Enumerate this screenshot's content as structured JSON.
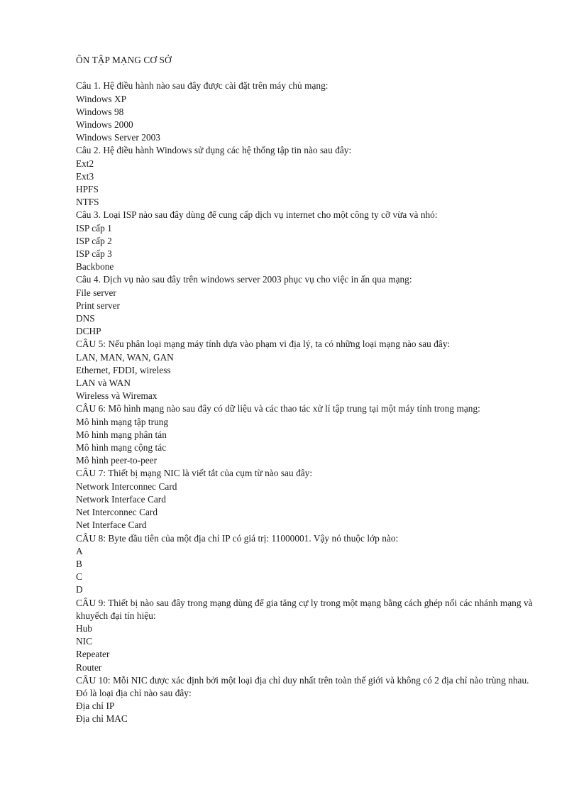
{
  "document": {
    "title": "ÔN TẬP MẠNG CƠ SỞ",
    "language": "Vietnamese",
    "page_background": "#ffffff",
    "text_color": "#1a1a1a",
    "questions": [
      {
        "stem": "Câu 1. Hệ điều hành nào sau đây được cài đặt trên máy chủ mạng:",
        "choices": [
          "Windows XP",
          "Windows 98",
          "Windows 2000",
          "Windows Server 2003"
        ]
      },
      {
        "stem": "Câu 2. Hệ điều hành Windows sử dụng các hệ thống tập tin nào sau đây:",
        "choices": [
          "Ext2",
          "Ext3",
          "HPFS",
          "NTFS"
        ]
      },
      {
        "stem": "Câu 3. Loại ISP nào sau đây dùng để cung cấp dịch vụ internet cho một công ty cỡ vừa và nhỏ:",
        "choices": [
          "ISP cấp 1",
          "ISP cấp 2",
          "ISP cấp 3",
          "Backbone"
        ]
      },
      {
        "stem": "Câu 4. Dịch vụ nào sau đây trên windows server 2003 phục vụ cho việc in ấn qua mạng:",
        "choices": [
          "File server",
          "Print server",
          "DNS",
          "DCHP"
        ]
      },
      {
        "stem": "CÂU 5: Nếu phân loại mạng máy tính dựa vào phạm vi địa lý, ta có những loại mạng nào sau đây:",
        "choices": [
          "LAN, MAN, WAN, GAN",
          "Ethernet, FDDI, wireless",
          "LAN và WAN",
          "Wireless và Wiremax"
        ]
      },
      {
        "stem": "CÂU 6: Mô hình mạng nào sau đây có dữ liệu và các thao tác xử lí tập trung tại một máy tính trong mạng:",
        "choices": [
          "Mô hình mạng tập trung",
          "Mô hình mạng phân tán",
          "Mô hình mạng cộng tác",
          "Mô hình peer-to-peer"
        ]
      },
      {
        "stem": "CÂU 7: Thiết bị mạng NIC là viết tắt của cụm từ nào sau đây:",
        "choices": [
          "Network Interconnec Card",
          "Network Interface Card",
          "Net Interconnec Card",
          "Net Interface Card"
        ]
      },
      {
        "stem": "CÂU 8: Byte đầu tiên của một địa chỉ IP có giá trị: 11000001. Vậy nó thuộc lớp nào:",
        "choices": [
          "A",
          "B",
          "C",
          "D"
        ]
      },
      {
        "stem": "CÂU 9: Thiết bị nào sau đây trong mạng dùng để gia tăng cự ly trong một mạng bằng cách ghép nối các nhánh mạng và khuyếch đại tín hiệu:",
        "choices": [
          "Hub",
          "NIC",
          "Repeater",
          "Router"
        ]
      },
      {
        "stem": "CÂU 10: Mỗi NIC được xác định bởi một loại địa chỉ duy nhất trên toàn thế giới và không có 2 địa chỉ nào trùng nhau. Đó là loại địa chỉ nào sau đây:",
        "choices": [
          "Địa chỉ IP",
          "Địa chỉ MAC"
        ]
      }
    ]
  }
}
